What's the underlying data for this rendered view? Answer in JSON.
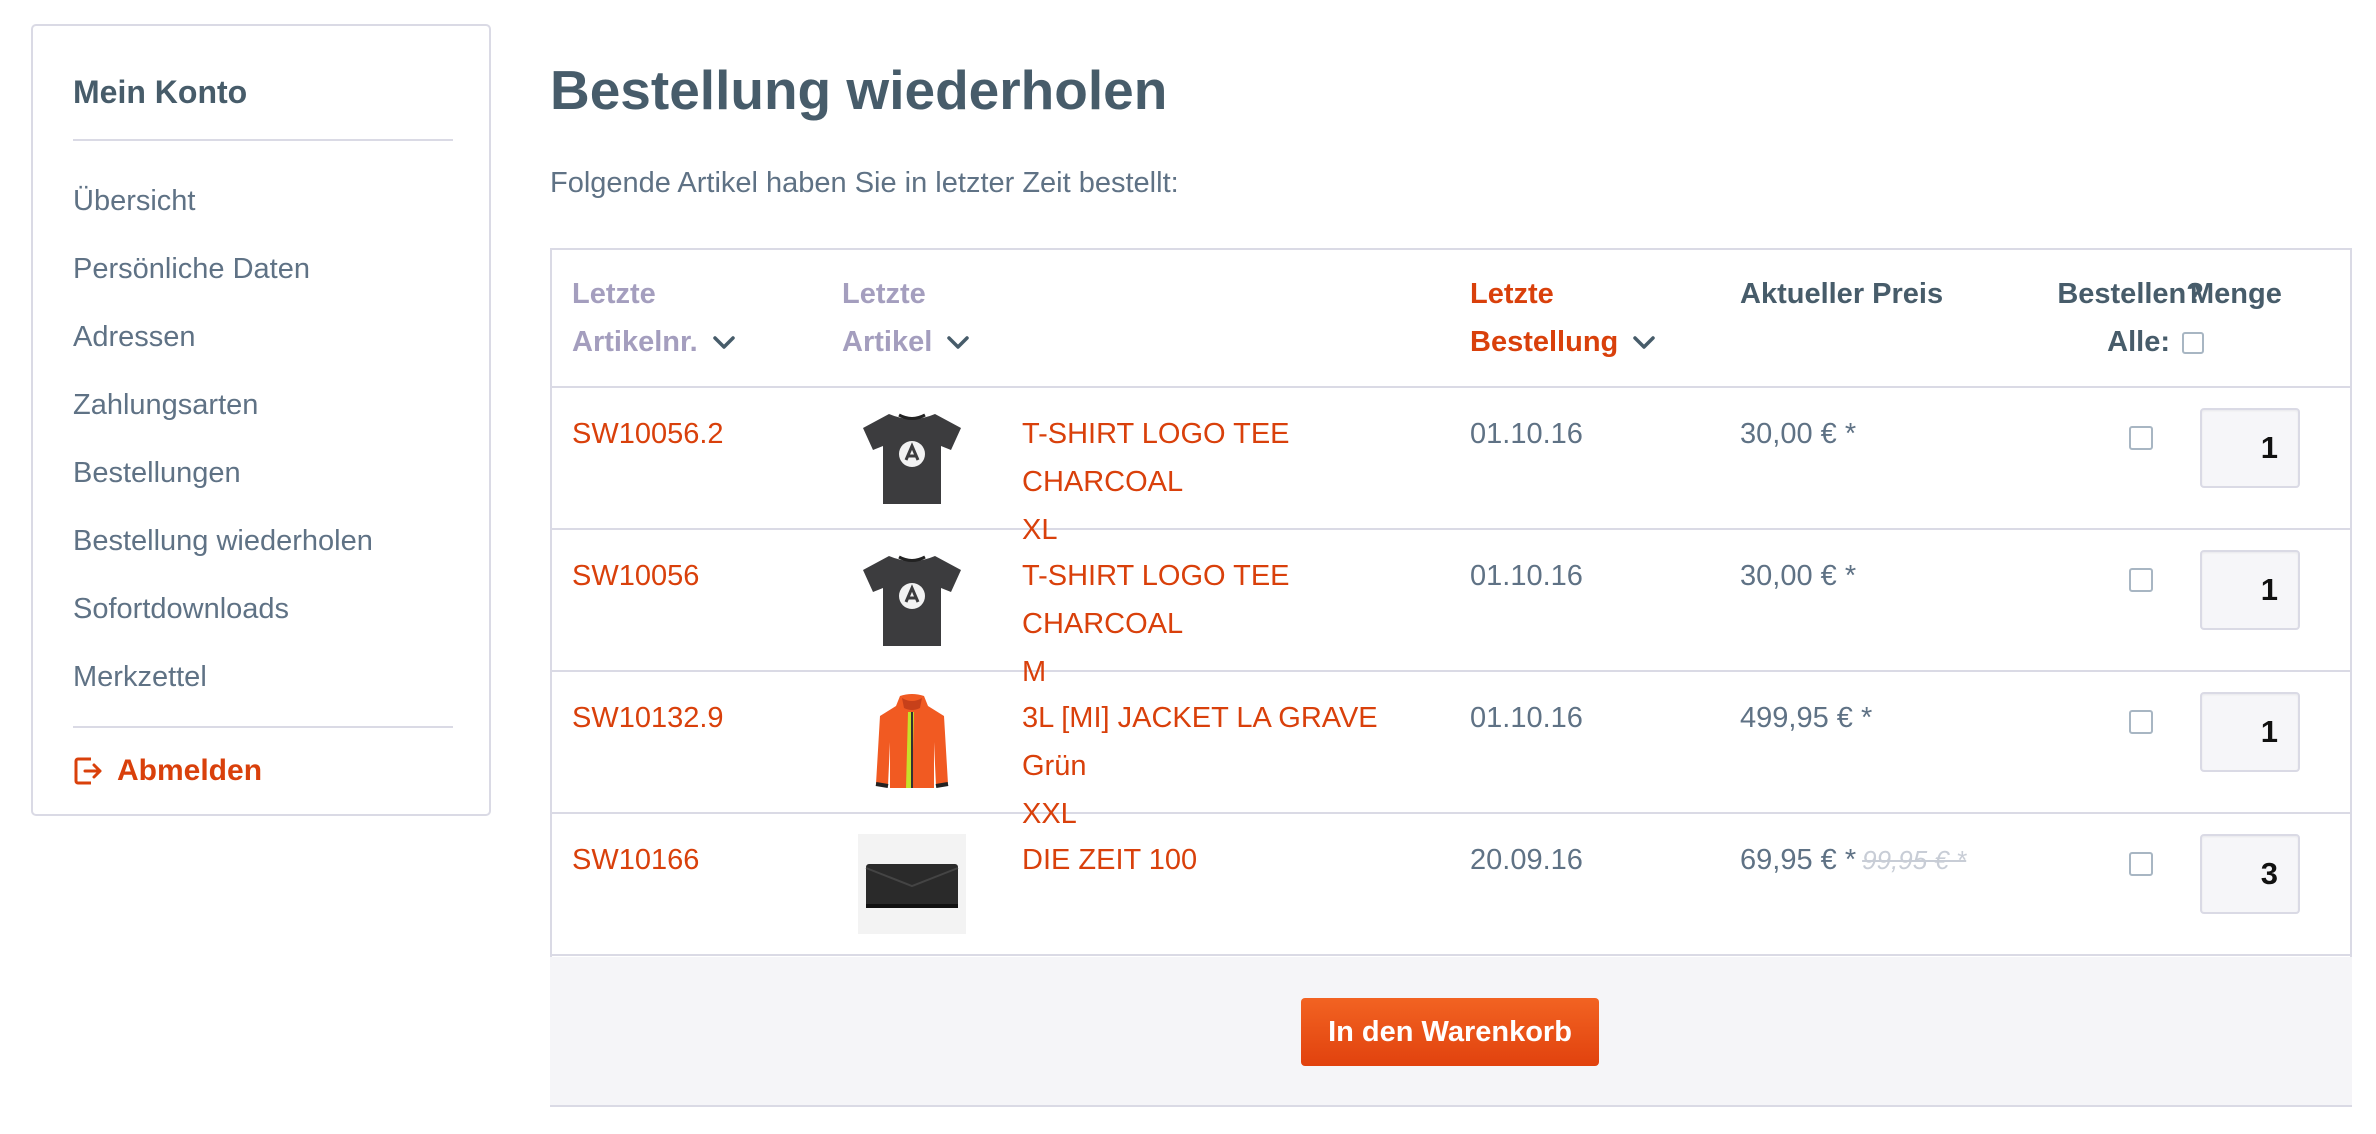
{
  "sidebar": {
    "title": "Mein Konto",
    "items": [
      {
        "label": "Übersicht"
      },
      {
        "label": "Persönliche Daten"
      },
      {
        "label": "Adressen"
      },
      {
        "label": "Zahlungsarten"
      },
      {
        "label": "Bestellungen"
      },
      {
        "label": "Bestellung wiederholen"
      },
      {
        "label": "Sofortdownloads"
      },
      {
        "label": "Merkzettel"
      }
    ],
    "logout_label": "Abmelden",
    "logout_icon": "logout-icon"
  },
  "main": {
    "title": "Bestellung wiederholen",
    "intro": "Folgende Artikel haben Sie in letzter Zeit bestellt:"
  },
  "table": {
    "headers": {
      "art_nr_line1": "Letzte",
      "art_nr_line2": "Artikelnr.",
      "art_line1": "Letzte",
      "art_line2": "Artikel",
      "order_line1": "Letzte",
      "order_line2": "Bestellung",
      "price": "Aktueller Preis",
      "bestellen": "Bestellen?",
      "alle": "Alle:",
      "menge": "Menge"
    },
    "rows": [
      {
        "nr": "SW10056.2",
        "image": "tshirt-charcoal",
        "name_line1": "T-SHIRT LOGO TEE CHARCOAL",
        "name_line2": "XL",
        "date": "01.10.16",
        "price": "30,00 € *",
        "old_price": "",
        "qty": "1"
      },
      {
        "nr": "SW10056",
        "image": "tshirt-charcoal",
        "name_line1": "T-SHIRT LOGO TEE CHARCOAL",
        "name_line2": "M",
        "date": "01.10.16",
        "price": "30,00 € *",
        "old_price": "",
        "qty": "1"
      },
      {
        "nr": "SW10132.9",
        "image": "orange-jacket",
        "name_line1": "3L [MI] JACKET LA GRAVE Grün",
        "name_line2": "XXL",
        "date": "01.10.16",
        "price": "499,95 € *",
        "old_price": "",
        "qty": "1"
      },
      {
        "nr": "SW10166",
        "image": "black-wallet",
        "name_line1": "DIE ZEIT 100",
        "name_line2": "",
        "date": "20.09.16",
        "price": "69,95 € *",
        "old_price": "99,95 € *",
        "qty": "3"
      }
    ]
  },
  "footer": {
    "cart_button": "In den Warenkorb"
  },
  "colors": {
    "accent": "#d9400b",
    "button": "#e1420e",
    "text": "#5f7285",
    "heading": "#475c6a",
    "border": "#dadae5"
  }
}
